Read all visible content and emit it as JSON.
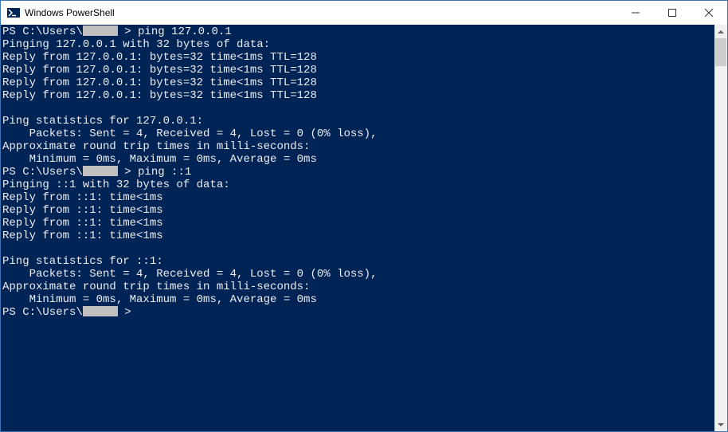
{
  "window": {
    "title": "Windows PowerShell"
  },
  "terminal": {
    "lines": [
      {
        "parts": [
          {
            "t": "PS C:\\Users\\"
          },
          {
            "redacted": true
          },
          {
            "t": " > ping 127.0.0.1"
          }
        ]
      },
      {
        "parts": [
          {
            "t": "Pinging 127.0.0.1 with 32 bytes of data:"
          }
        ]
      },
      {
        "parts": [
          {
            "t": "Reply from 127.0.0.1: bytes=32 time<1ms TTL=128"
          }
        ]
      },
      {
        "parts": [
          {
            "t": "Reply from 127.0.0.1: bytes=32 time<1ms TTL=128"
          }
        ]
      },
      {
        "parts": [
          {
            "t": "Reply from 127.0.0.1: bytes=32 time<1ms TTL=128"
          }
        ]
      },
      {
        "parts": [
          {
            "t": "Reply from 127.0.0.1: bytes=32 time<1ms TTL=128"
          }
        ]
      },
      {
        "parts": [
          {
            "t": ""
          }
        ]
      },
      {
        "parts": [
          {
            "t": "Ping statistics for 127.0.0.1:"
          }
        ]
      },
      {
        "parts": [
          {
            "t": "    Packets: Sent = 4, Received = 4, Lost = 0 (0% loss),"
          }
        ]
      },
      {
        "parts": [
          {
            "t": "Approximate round trip times in milli-seconds:"
          }
        ]
      },
      {
        "parts": [
          {
            "t": "    Minimum = 0ms, Maximum = 0ms, Average = 0ms"
          }
        ]
      },
      {
        "parts": [
          {
            "t": "PS C:\\Users\\"
          },
          {
            "redacted": true
          },
          {
            "t": " > ping ::1"
          }
        ]
      },
      {
        "parts": [
          {
            "t": "Pinging ::1 with 32 bytes of data:"
          }
        ]
      },
      {
        "parts": [
          {
            "t": "Reply from ::1: time<1ms"
          }
        ]
      },
      {
        "parts": [
          {
            "t": "Reply from ::1: time<1ms"
          }
        ]
      },
      {
        "parts": [
          {
            "t": "Reply from ::1: time<1ms"
          }
        ]
      },
      {
        "parts": [
          {
            "t": "Reply from ::1: time<1ms"
          }
        ]
      },
      {
        "parts": [
          {
            "t": ""
          }
        ]
      },
      {
        "parts": [
          {
            "t": "Ping statistics for ::1:"
          }
        ]
      },
      {
        "parts": [
          {
            "t": "    Packets: Sent = 4, Received = 4, Lost = 0 (0% loss),"
          }
        ]
      },
      {
        "parts": [
          {
            "t": "Approximate round trip times in milli-seconds:"
          }
        ]
      },
      {
        "parts": [
          {
            "t": "    Minimum = 0ms, Maximum = 0ms, Average = 0ms"
          }
        ]
      },
      {
        "parts": [
          {
            "t": "PS C:\\Users\\"
          },
          {
            "redacted": true
          },
          {
            "t": " >"
          }
        ]
      }
    ]
  }
}
